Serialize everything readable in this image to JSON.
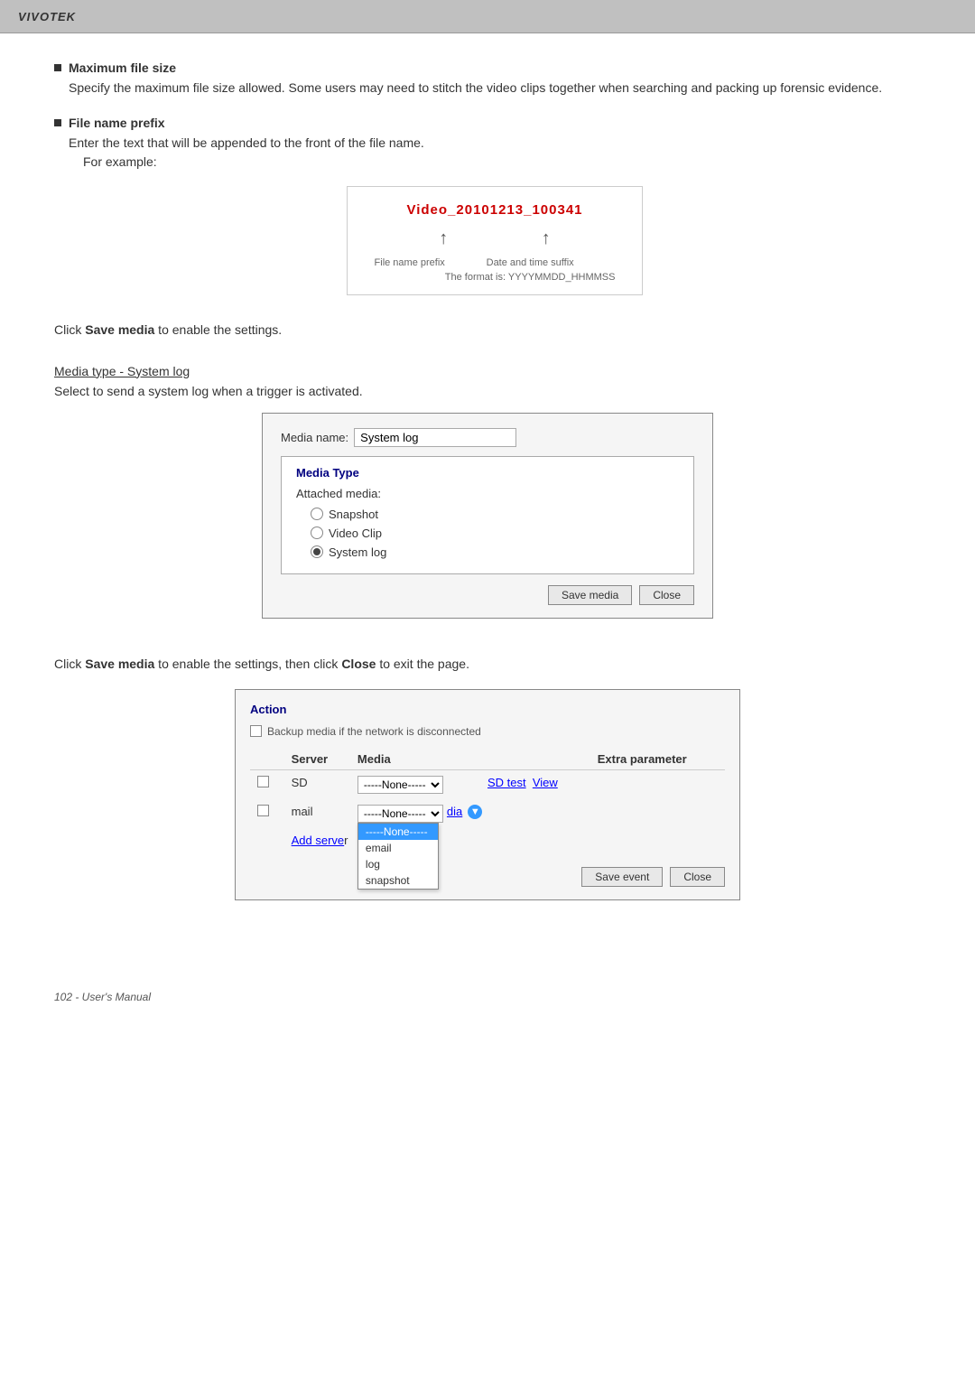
{
  "header": {
    "brand": "VIVOTEK"
  },
  "section1": {
    "bullet1": {
      "title": "Maximum file size",
      "desc": "Specify the maximum file size allowed. Some users may need to stitch the video clips together when searching and packing up forensic evidence."
    },
    "bullet2": {
      "title": "File name prefix",
      "desc": "Enter the text that will be appended to the front of the file name.",
      "for_example": "For example:",
      "filename": "Video_20101213_100341",
      "label_left": "File name prefix",
      "label_right": "Date and time suffix\nThe format is: YYYYMMDD_HHMMSS"
    },
    "save_media_line": "Click Save media to enable the settings.",
    "save_media_bold": "Save media"
  },
  "section2": {
    "heading": "Media type - System log",
    "desc": "Select to send a system log when a trigger is activated.",
    "dialog": {
      "media_name_label": "Media name:",
      "media_name_value": "System log",
      "media_type_title": "Media Type",
      "attached_media_label": "Attached media:",
      "radio_options": [
        {
          "label": "Snapshot",
          "selected": false
        },
        {
          "label": "Video Clip",
          "selected": false
        },
        {
          "label": "System log",
          "selected": true
        }
      ],
      "btn_save": "Save media",
      "btn_close": "Close"
    }
  },
  "section3": {
    "save_line_pre": "Click ",
    "save_bold": "Save media",
    "save_line_mid": " to enable the settings, then click ",
    "close_bold": "Close",
    "save_line_post": " to exit the page.",
    "action": {
      "title": "Action",
      "backup_label": "Backup media if the network is disconnected",
      "table": {
        "headers": [
          "",
          "Server",
          "Media",
          "",
          "Extra parameter"
        ],
        "rows": [
          {
            "checked": false,
            "server": "SD",
            "media_dropdown": "-----None-----",
            "links": [
              "SD test",
              "View"
            ],
            "extra": ""
          },
          {
            "checked": false,
            "server": "mail",
            "media_dropdown": "-----None-----",
            "links": [],
            "extra": ""
          }
        ]
      },
      "add_server_link": "Add serve",
      "dropdown_open": {
        "items": [
          "-----None-----",
          "email",
          "log",
          "snapshot"
        ],
        "selected": "-----None-----"
      },
      "media_link": "dia",
      "btn_save_event": "Save event",
      "btn_close": "Close"
    }
  },
  "footer": {
    "text": "102 - User's Manual"
  }
}
